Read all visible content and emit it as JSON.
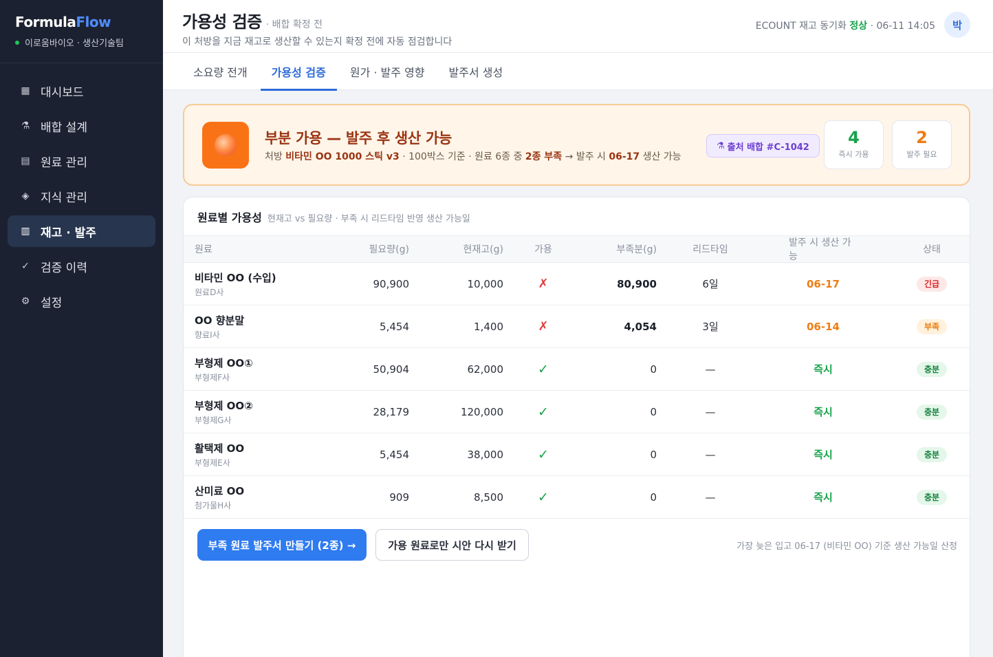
{
  "brand": {
    "part1": "Formula",
    "part2": "Flow",
    "org": "이로움바이오 · 생산기술팀"
  },
  "nav": [
    {
      "icon": "▦",
      "icon_name": "grid-icon",
      "label": "대시보드",
      "active": false
    },
    {
      "icon": "⚗",
      "icon_name": "flask-icon",
      "label": "배합 설계",
      "active": false
    },
    {
      "icon": "▤",
      "icon_name": "list-icon",
      "label": "원료 관리",
      "active": false
    },
    {
      "icon": "◈",
      "icon_name": "diamond-icon",
      "label": "지식 관리",
      "active": false
    },
    {
      "icon": "▥",
      "icon_name": "barcode-icon",
      "label": "재고 · 발주",
      "active": true
    },
    {
      "icon": "✓",
      "icon_name": "check-icon",
      "label": "검증 이력",
      "active": false
    },
    {
      "icon": "⚙",
      "icon_name": "gear-icon",
      "label": "설정",
      "active": false
    }
  ],
  "header": {
    "title": "가용성 검증",
    "subtitle": "· 배합 확정 전",
    "description": "이 처방을 지금 재고로 생산할 수 있는지 확정 전에 자동 점검합니다",
    "sync_prefix": "ECOUNT 재고 동기화",
    "sync_status": "정상",
    "sync_time": "· 06-11 14:05",
    "avatar": "박"
  },
  "tabs": [
    {
      "label": "소요량 전개",
      "active": false
    },
    {
      "label": "가용성 검증",
      "active": true
    },
    {
      "label": "원가 · 발주 영향",
      "active": false
    },
    {
      "label": "발주서 생성",
      "active": false
    }
  ],
  "banner": {
    "title": "부분 가용 — 발주 후 생산 가능",
    "text_1": "처방 ",
    "recipe": "비타민 OO 1000 스틱 v3",
    "text_2": " · 100박스 기준 · 원료 6종 중 ",
    "shortage": "2종 부족",
    "text_3": " → 발주 시 ",
    "date": "06-17",
    "text_4": " 생산 가능",
    "source_badge": "출처 배합 #C-1042",
    "stat_ok_value": "4",
    "stat_ok_label": "즉시 가용",
    "stat_order_value": "2",
    "stat_order_label": "발주 필요"
  },
  "table": {
    "title": "원료별 가용성",
    "subtitle": "현재고 vs 필요량 · 부족 시 리드타임 반영 생산 가능일",
    "columns": {
      "name": "원료",
      "required": "필요량(g)",
      "stock": "현재고(g)",
      "avail": "가용",
      "short": "부족분(g)",
      "lead": "리드타임",
      "date": "발주 시 생산 가능",
      "status": "상태"
    },
    "rows": [
      {
        "name": "비타민 OO (수입)",
        "supplier": "원료D사",
        "required": "90,900",
        "stock": "10,000",
        "avail": "✗",
        "short": "80,900",
        "lead": "6일",
        "date": "06-17",
        "status": "긴급"
      },
      {
        "name": "OO 향분말",
        "supplier": "향료I사",
        "required": "5,454",
        "stock": "1,400",
        "avail": "✗",
        "short": "4,054",
        "lead": "3일",
        "date": "06-14",
        "status": "부족"
      },
      {
        "name": "부형제 OO①",
        "supplier": "부형제F사",
        "required": "50,904",
        "stock": "62,000",
        "avail": "✓",
        "short": "0",
        "lead": "—",
        "date": "즉시",
        "status": "충분"
      },
      {
        "name": "부형제 OO②",
        "supplier": "부형제G사",
        "required": "28,179",
        "stock": "120,000",
        "avail": "✓",
        "short": "0",
        "lead": "—",
        "date": "즉시",
        "status": "충분"
      },
      {
        "name": "활택제 OO",
        "supplier": "부형제E사",
        "required": "5,454",
        "stock": "38,000",
        "avail": "✓",
        "short": "0",
        "lead": "—",
        "date": "즉시",
        "status": "충분"
      },
      {
        "name": "산미료 OO",
        "supplier": "첨가물H사",
        "required": "909",
        "stock": "8,500",
        "avail": "✓",
        "short": "0",
        "lead": "—",
        "date": "즉시",
        "status": "충분"
      }
    ]
  },
  "actions": {
    "primary": "부족 원료 발주서 만들기 (2종) →",
    "secondary": "가용 원료로만 시안 다시 받기",
    "note": "가장 늦은 입고 06-17 (비타민 OO) 기준 생산 가능일 산정"
  },
  "colors": {
    "accent": "#2f7bf0",
    "warning": "#f07c12",
    "danger": "#dc2626",
    "success": "#16a34a",
    "sidebar": "#1b2130"
  }
}
